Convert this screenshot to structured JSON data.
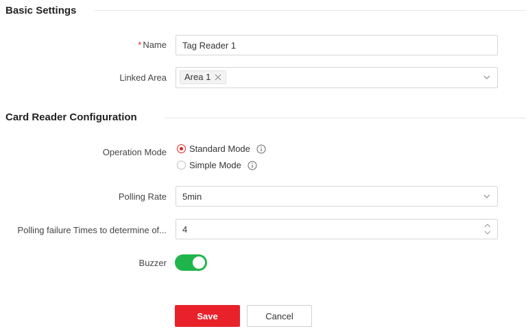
{
  "colors": {
    "accent": "#e8212b",
    "required": "#e02020",
    "toggle_on": "#20b54b"
  },
  "basic_settings": {
    "title": "Basic Settings",
    "name": {
      "required_mark": "*",
      "label": "Name",
      "value": "Tag Reader 1"
    },
    "linked_area": {
      "label": "Linked Area",
      "selected_tags": [
        "Area 1"
      ]
    }
  },
  "card_reader_configuration": {
    "title": "Card Reader Configuration",
    "operation_mode": {
      "label": "Operation Mode",
      "options": [
        {
          "label": "Standard Mode",
          "checked": true,
          "icon": "info-icon"
        },
        {
          "label": "Simple Mode",
          "checked": false,
          "icon": "info-icon"
        }
      ]
    },
    "polling_rate": {
      "label": "Polling Rate",
      "value": "5min"
    },
    "polling_failure": {
      "label": "Polling failure Times to determine of...",
      "value": "4"
    },
    "buzzer": {
      "label": "Buzzer",
      "enabled": true
    }
  },
  "actions": {
    "save_label": "Save",
    "cancel_label": "Cancel"
  }
}
